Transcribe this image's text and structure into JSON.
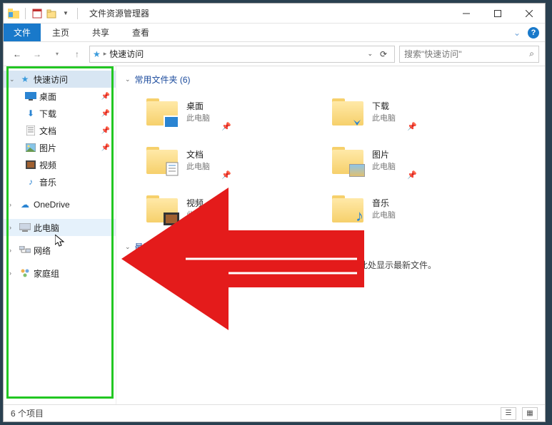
{
  "titlebar": {
    "title": "文件资源管理器"
  },
  "ribbon": {
    "file": "文件",
    "tabs": [
      "主页",
      "共享",
      "查看"
    ]
  },
  "address": {
    "path": "快速访问",
    "search_placeholder": "搜索\"快速访问\""
  },
  "sidebar": {
    "quick_access": "快速访问",
    "items": [
      {
        "label": "桌面",
        "icon": "desktop"
      },
      {
        "label": "下载",
        "icon": "download"
      },
      {
        "label": "文档",
        "icon": "document"
      },
      {
        "label": "图片",
        "icon": "picture"
      },
      {
        "label": "视频",
        "icon": "video"
      },
      {
        "label": "音乐",
        "icon": "music"
      }
    ],
    "onedrive": "OneDrive",
    "this_pc": "此电脑",
    "network": "网络",
    "homegroup": "家庭组"
  },
  "content": {
    "section_folders": "常用文件夹 (6)",
    "section_recent": "最近使用的文件 (0)",
    "pc_label": "此电脑",
    "folders": [
      {
        "name": "桌面"
      },
      {
        "name": "下载"
      },
      {
        "name": "文档"
      },
      {
        "name": "图片"
      },
      {
        "name": "视频"
      },
      {
        "name": "音乐"
      }
    ],
    "empty_recent": "在你打开某些文件后，我们会在此处显示最新文件。"
  },
  "statusbar": {
    "count": "6 个项目"
  }
}
